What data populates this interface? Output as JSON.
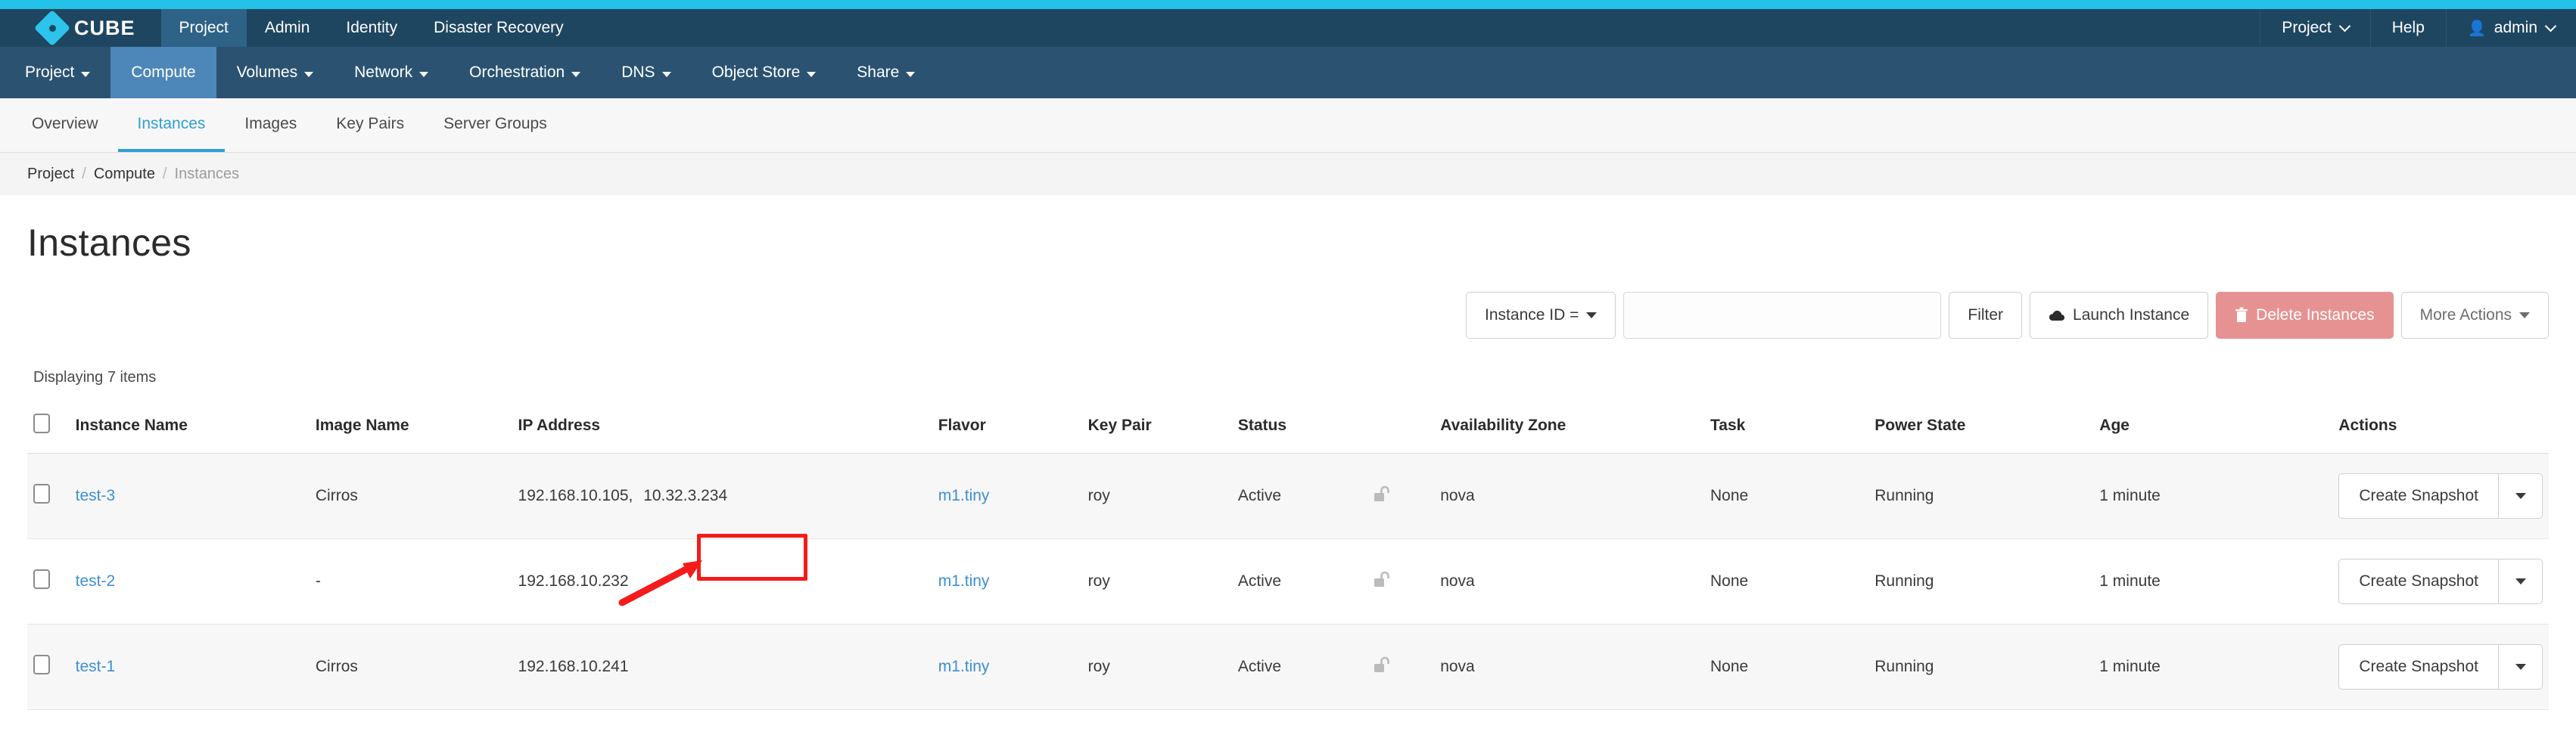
{
  "theme": {
    "accent_cyan": "#24c1e8",
    "topbar_bg": "#1f4661",
    "subnav_bg": "#2b5371",
    "subnav_active": "#4d86b8",
    "tab_active": "#2e9fd4",
    "link_blue": "#3d8fd1",
    "danger_bg": "#e79292",
    "annotation_red": "#f51b1b"
  },
  "brand": {
    "name": "CUBE",
    "logo_icon": "diamond-logo-icon"
  },
  "topnav": {
    "items": [
      {
        "label": "Project",
        "active": true
      },
      {
        "label": "Admin",
        "active": false
      },
      {
        "label": "Identity",
        "active": false
      },
      {
        "label": "Disaster Recovery",
        "active": false
      }
    ],
    "right": {
      "project_switcher": "Project",
      "help": "Help",
      "user": "admin",
      "user_icon": "user-icon"
    }
  },
  "subnav": {
    "items": [
      {
        "label": "Project",
        "has_caret": true,
        "active": false
      },
      {
        "label": "Compute",
        "has_caret": false,
        "active": true
      },
      {
        "label": "Volumes",
        "has_caret": true,
        "active": false
      },
      {
        "label": "Network",
        "has_caret": true,
        "active": false
      },
      {
        "label": "Orchestration",
        "has_caret": true,
        "active": false
      },
      {
        "label": "DNS",
        "has_caret": true,
        "active": false
      },
      {
        "label": "Object Store",
        "has_caret": true,
        "active": false
      },
      {
        "label": "Share",
        "has_caret": true,
        "active": false
      }
    ]
  },
  "tabs": {
    "items": [
      {
        "label": "Overview",
        "active": false
      },
      {
        "label": "Instances",
        "active": true
      },
      {
        "label": "Images",
        "active": false
      },
      {
        "label": "Key Pairs",
        "active": false
      },
      {
        "label": "Server Groups",
        "active": false
      }
    ]
  },
  "breadcrumb": {
    "items": [
      "Project",
      "Compute",
      "Instances"
    ],
    "separator": "/"
  },
  "page": {
    "title": "Instances"
  },
  "toolbar": {
    "filter_select_label": "Instance ID =",
    "search_value": "",
    "search_placeholder": "",
    "filter_button": "Filter",
    "launch_button": "Launch Instance",
    "launch_icon": "upload-cloud-icon",
    "delete_button": "Delete Instances",
    "delete_icon": "trash-icon",
    "more_actions_button": "More Actions"
  },
  "table": {
    "count_text": "Displaying 7 items",
    "headers": [
      "Instance Name",
      "Image Name",
      "IP Address",
      "Flavor",
      "Key Pair",
      "Status",
      "",
      "Availability Zone",
      "Task",
      "Power State",
      "Age",
      "Actions"
    ],
    "action_label": "Create Snapshot",
    "rows": [
      {
        "name": "test-3",
        "image": "Cirros",
        "ip_primary": "192.168.10.105,",
        "ip_highlighted": "10.32.3.234",
        "flavor": "m1.tiny",
        "keypair": "roy",
        "status": "Active",
        "lock_icon": "unlocked-padlock-icon",
        "az": "nova",
        "task": "None",
        "power": "Running",
        "age": "1 minute",
        "shaded": true
      },
      {
        "name": "test-2",
        "image": "-",
        "ip_primary": "192.168.10.232",
        "ip_highlighted": "",
        "flavor": "m1.tiny",
        "keypair": "roy",
        "status": "Active",
        "lock_icon": "unlocked-padlock-icon",
        "az": "nova",
        "task": "None",
        "power": "Running",
        "age": "1 minute",
        "shaded": false
      },
      {
        "name": "test-1",
        "image": "Cirros",
        "ip_primary": "192.168.10.241",
        "ip_highlighted": "",
        "flavor": "m1.tiny",
        "keypair": "roy",
        "status": "Active",
        "lock_icon": "unlocked-padlock-icon",
        "az": "nova",
        "task": "None",
        "power": "Running",
        "age": "1 minute",
        "shaded": true
      }
    ]
  },
  "annotation": {
    "target_text": "10.32.3.234",
    "shape": "red-rectangle-with-arrow"
  }
}
